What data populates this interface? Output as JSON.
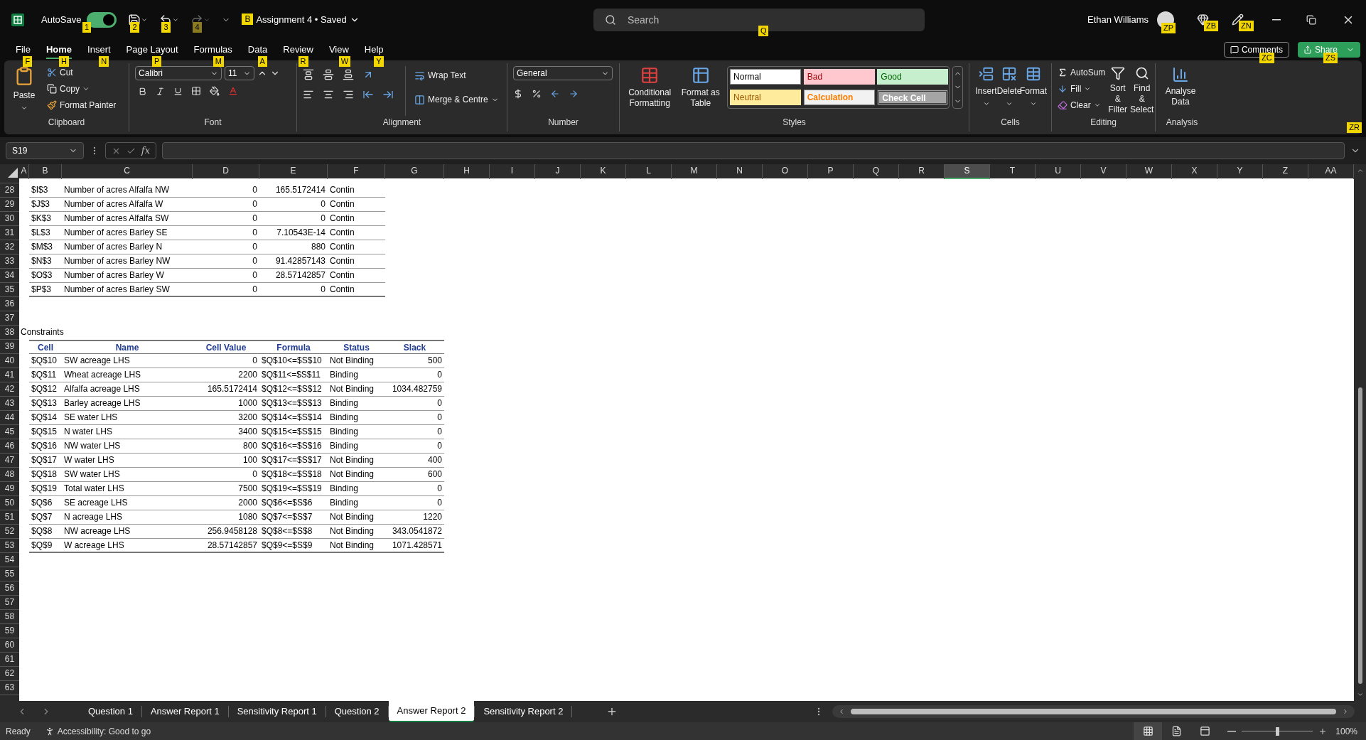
{
  "title_bar": {
    "autosave": {
      "label": "AutoSave",
      "on": true,
      "keytip": "1"
    },
    "quick_access": [
      {
        "kind": "save",
        "keytip": "2",
        "disabled": false
      },
      {
        "kind": "undo",
        "keytip": "3",
        "disabled": false
      },
      {
        "kind": "redo",
        "keytip": "4",
        "disabled": true
      }
    ],
    "document": {
      "title": "Assignment 4 • Saved",
      "keytip": "B"
    },
    "search": {
      "placeholder": "Search",
      "keytip": "Q"
    },
    "user": {
      "name": "Ethan Williams",
      "keytip": "ZP"
    },
    "icons": [
      {
        "kind": "gem",
        "keytip": "ZB"
      },
      {
        "kind": "pen",
        "keytip": "ZN"
      }
    ]
  },
  "menu_tabs": [
    {
      "label": "File",
      "keytip": "F",
      "selected": false
    },
    {
      "label": "Home",
      "keytip": "H",
      "selected": true
    },
    {
      "label": "Insert",
      "keytip": "N",
      "selected": false
    },
    {
      "label": "Page Layout",
      "keytip": "P",
      "selected": false
    },
    {
      "label": "Formulas",
      "keytip": "M",
      "selected": false
    },
    {
      "label": "Data",
      "keytip": "A",
      "selected": false
    },
    {
      "label": "Review",
      "keytip": "R",
      "selected": false
    },
    {
      "label": "View",
      "keytip": "W",
      "selected": false
    },
    {
      "label": "Help",
      "keytip": "Y",
      "selected": false
    }
  ],
  "comments_button": {
    "label": "Comments",
    "keytip": "ZC"
  },
  "share_button": {
    "label": "Share",
    "keytip": "ZS"
  },
  "ribbon_collapse_keytip": "ZR",
  "ribbon": {
    "clipboard": {
      "label": "Clipboard",
      "paste": "Paste",
      "cut": "Cut",
      "copy": "Copy",
      "format_painter": "Format Painter"
    },
    "font": {
      "label": "Font",
      "family": "Calibri",
      "size": "11"
    },
    "alignment": {
      "label": "Alignment",
      "wrap_text": "Wrap Text",
      "merge": "Merge & Centre"
    },
    "number": {
      "label": "Number",
      "format": "General"
    },
    "styles": {
      "label": "Styles",
      "conditional": "Conditional Formatting",
      "format_table": "Format as Table",
      "cell_styles": [
        {
          "name": "Normal",
          "kind": "normal"
        },
        {
          "name": "Bad",
          "kind": "bad"
        },
        {
          "name": "Good",
          "kind": "good"
        },
        {
          "name": "Neutral",
          "kind": "neutral"
        },
        {
          "name": "Calculation",
          "kind": "calculation"
        },
        {
          "name": "Check Cell",
          "kind": "check"
        }
      ]
    },
    "cells": {
      "label": "Cells",
      "buttons": [
        {
          "label": "Insert",
          "kind": "insert"
        },
        {
          "label": "Delete",
          "kind": "delete"
        },
        {
          "label": "Format",
          "kind": "format"
        }
      ]
    },
    "editing": {
      "label": "Editing",
      "autosum": "AutoSum",
      "fill": "Fill",
      "clear": "Clear",
      "sort": "Sort & Filter",
      "find": "Find & Select"
    },
    "analysis": {
      "label": "Analysis",
      "analyse": "Analyse Data"
    }
  },
  "formula_bar": {
    "name_box": "S19",
    "fx": "fx"
  },
  "sheet": {
    "columns": [
      {
        "label": "A",
        "selected": false
      },
      {
        "label": "B",
        "selected": false
      },
      {
        "label": "C",
        "selected": false
      },
      {
        "label": "D",
        "selected": false
      },
      {
        "label": "E",
        "selected": false
      },
      {
        "label": "F",
        "selected": false
      },
      {
        "label": "G",
        "selected": false
      },
      {
        "label": "H",
        "selected": false
      },
      {
        "label": "I",
        "selected": false
      },
      {
        "label": "J",
        "selected": false
      },
      {
        "label": "K",
        "selected": false
      },
      {
        "label": "L",
        "selected": false
      },
      {
        "label": "M",
        "selected": false
      },
      {
        "label": "N",
        "selected": false
      },
      {
        "label": "O",
        "selected": false
      },
      {
        "label": "P",
        "selected": false
      },
      {
        "label": "Q",
        "selected": false
      },
      {
        "label": "R",
        "selected": false
      },
      {
        "label": "S",
        "selected": true
      },
      {
        "label": "T",
        "selected": false
      },
      {
        "label": "U",
        "selected": false
      },
      {
        "label": "V",
        "selected": false
      },
      {
        "label": "W",
        "selected": false
      },
      {
        "label": "X",
        "selected": false
      },
      {
        "label": "Y",
        "selected": false
      },
      {
        "label": "Z",
        "selected": false
      },
      {
        "label": "AA",
        "selected": false
      }
    ],
    "row_numbers": [
      "28",
      "29",
      "30",
      "31",
      "32",
      "33",
      "34",
      "35",
      "36",
      "37",
      "38",
      "39",
      "40",
      "41",
      "42",
      "43",
      "44",
      "45",
      "46",
      "47",
      "48",
      "49",
      "50",
      "51",
      "52",
      "53",
      "54",
      "55",
      "56",
      "57",
      "58",
      "59",
      "60",
      "61",
      "62",
      "63"
    ]
  },
  "variable_cells": {
    "rows": [
      {
        "cell": "$I$3",
        "name": "Number of acres Alfalfa NW",
        "column_d": "0",
        "column_e": "165.5172414",
        "column_f": "Contin"
      },
      {
        "cell": "$J$3",
        "name": "Number of acres Alfalfa W",
        "column_d": "0",
        "column_e": "0",
        "column_f": "Contin"
      },
      {
        "cell": "$K$3",
        "name": "Number of acres Alfalfa SW",
        "column_d": "0",
        "column_e": "0",
        "column_f": "Contin"
      },
      {
        "cell": "$L$3",
        "name": "Number of acres Barley SE",
        "column_d": "0",
        "column_e": "7.10543E-14",
        "column_f": "Contin"
      },
      {
        "cell": "$M$3",
        "name": "Number of acres Barley N",
        "column_d": "0",
        "column_e": "880",
        "column_f": "Contin"
      },
      {
        "cell": "$N$3",
        "name": "Number of acres Barley NW",
        "column_d": "0",
        "column_e": "91.42857143",
        "column_f": "Contin"
      },
      {
        "cell": "$O$3",
        "name": "Number of acres Barley W",
        "column_d": "0",
        "column_e": "28.57142857",
        "column_f": "Contin"
      },
      {
        "cell": "$P$3",
        "name": "Number of acres Barley SW",
        "column_d": "0",
        "column_e": "0",
        "column_f": "Contin"
      }
    ]
  },
  "constraints": {
    "title": "Constraints",
    "columns": [
      "Cell",
      "Name",
      "Cell Value",
      "Formula",
      "Status",
      "Slack"
    ],
    "rows": [
      [
        "$Q$10",
        "SW acreage LHS",
        "0",
        "$Q$10<=$S$10",
        "Not Binding",
        "500"
      ],
      [
        "$Q$11",
        "Wheat acreage LHS",
        "2200",
        "$Q$11<=$S$11",
        "Binding",
        "0"
      ],
      [
        "$Q$12",
        "Alfalfa acreage LHS",
        "165.5172414",
        "$Q$12<=$S$12",
        "Not Binding",
        "1034.482759"
      ],
      [
        "$Q$13",
        "Barley acreage LHS",
        "1000",
        "$Q$13<=$S$13",
        "Binding",
        "0"
      ],
      [
        "$Q$14",
        "SE water LHS",
        "3200",
        "$Q$14<=$S$14",
        "Binding",
        "0"
      ],
      [
        "$Q$15",
        "N water LHS",
        "3400",
        "$Q$15<=$S$15",
        "Binding",
        "0"
      ],
      [
        "$Q$16",
        "NW water LHS",
        "800",
        "$Q$16<=$S$16",
        "Binding",
        "0"
      ],
      [
        "$Q$17",
        "W water LHS",
        "100",
        "$Q$17<=$S$17",
        "Not Binding",
        "400"
      ],
      [
        "$Q$18",
        "SW water LHS",
        "0",
        "$Q$18<=$S$18",
        "Not Binding",
        "600"
      ],
      [
        "$Q$19",
        "Total water LHS",
        "7500",
        "$Q$19<=$S$19",
        "Binding",
        "0"
      ],
      [
        "$Q$6",
        "SE acreage LHS",
        "2000",
        "$Q$6<=$S$6",
        "Binding",
        "0"
      ],
      [
        "$Q$7",
        "N acreage LHS",
        "1080",
        "$Q$7<=$S$7",
        "Not Binding",
        "1220"
      ],
      [
        "$Q$8",
        "NW acreage LHS",
        "256.9458128",
        "$Q$8<=$S$8",
        "Not Binding",
        "343.0541872"
      ],
      [
        "$Q$9",
        "W acreage LHS",
        "28.57142857",
        "$Q$9<=$S$9",
        "Not Binding",
        "1071.428571"
      ]
    ]
  },
  "sheet_tabs": [
    {
      "label": "Question 1",
      "selected": false
    },
    {
      "label": "Answer Report 1",
      "selected": false
    },
    {
      "label": "Sensitivity Report 1",
      "selected": false
    },
    {
      "label": "Question 2",
      "selected": false
    },
    {
      "label": "Answer Report 2",
      "selected": true
    },
    {
      "label": "Sensitivity Report 2",
      "selected": false
    }
  ],
  "status_bar": {
    "ready": "Ready",
    "accessibility": "Accessibility: Good to go",
    "views": [
      {
        "kind": "normal",
        "selected": true
      },
      {
        "kind": "page_layout",
        "selected": false
      },
      {
        "kind": "page_break",
        "selected": false
      }
    ],
    "zoom": {
      "level": 0.5,
      "reading": "100%"
    }
  }
}
